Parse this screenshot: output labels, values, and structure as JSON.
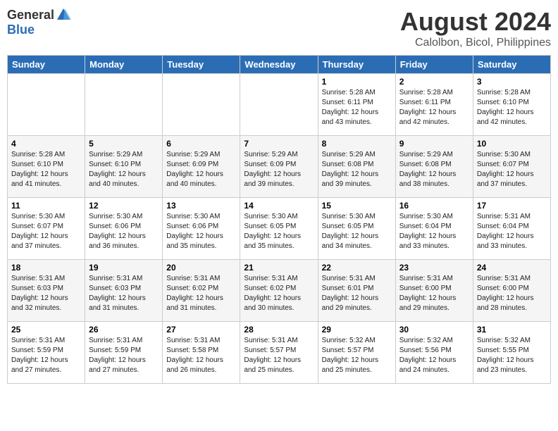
{
  "header": {
    "logo_general": "General",
    "logo_blue": "Blue",
    "month_year": "August 2024",
    "location": "Calolbon, Bicol, Philippines"
  },
  "days_of_week": [
    "Sunday",
    "Monday",
    "Tuesday",
    "Wednesday",
    "Thursday",
    "Friday",
    "Saturday"
  ],
  "weeks": [
    [
      {
        "day": "",
        "info": ""
      },
      {
        "day": "",
        "info": ""
      },
      {
        "day": "",
        "info": ""
      },
      {
        "day": "",
        "info": ""
      },
      {
        "day": "1",
        "info": "Sunrise: 5:28 AM\nSunset: 6:11 PM\nDaylight: 12 hours\nand 43 minutes."
      },
      {
        "day": "2",
        "info": "Sunrise: 5:28 AM\nSunset: 6:11 PM\nDaylight: 12 hours\nand 42 minutes."
      },
      {
        "day": "3",
        "info": "Sunrise: 5:28 AM\nSunset: 6:10 PM\nDaylight: 12 hours\nand 42 minutes."
      }
    ],
    [
      {
        "day": "4",
        "info": "Sunrise: 5:28 AM\nSunset: 6:10 PM\nDaylight: 12 hours\nand 41 minutes."
      },
      {
        "day": "5",
        "info": "Sunrise: 5:29 AM\nSunset: 6:10 PM\nDaylight: 12 hours\nand 40 minutes."
      },
      {
        "day": "6",
        "info": "Sunrise: 5:29 AM\nSunset: 6:09 PM\nDaylight: 12 hours\nand 40 minutes."
      },
      {
        "day": "7",
        "info": "Sunrise: 5:29 AM\nSunset: 6:09 PM\nDaylight: 12 hours\nand 39 minutes."
      },
      {
        "day": "8",
        "info": "Sunrise: 5:29 AM\nSunset: 6:08 PM\nDaylight: 12 hours\nand 39 minutes."
      },
      {
        "day": "9",
        "info": "Sunrise: 5:29 AM\nSunset: 6:08 PM\nDaylight: 12 hours\nand 38 minutes."
      },
      {
        "day": "10",
        "info": "Sunrise: 5:30 AM\nSunset: 6:07 PM\nDaylight: 12 hours\nand 37 minutes."
      }
    ],
    [
      {
        "day": "11",
        "info": "Sunrise: 5:30 AM\nSunset: 6:07 PM\nDaylight: 12 hours\nand 37 minutes."
      },
      {
        "day": "12",
        "info": "Sunrise: 5:30 AM\nSunset: 6:06 PM\nDaylight: 12 hours\nand 36 minutes."
      },
      {
        "day": "13",
        "info": "Sunrise: 5:30 AM\nSunset: 6:06 PM\nDaylight: 12 hours\nand 35 minutes."
      },
      {
        "day": "14",
        "info": "Sunrise: 5:30 AM\nSunset: 6:05 PM\nDaylight: 12 hours\nand 35 minutes."
      },
      {
        "day": "15",
        "info": "Sunrise: 5:30 AM\nSunset: 6:05 PM\nDaylight: 12 hours\nand 34 minutes."
      },
      {
        "day": "16",
        "info": "Sunrise: 5:30 AM\nSunset: 6:04 PM\nDaylight: 12 hours\nand 33 minutes."
      },
      {
        "day": "17",
        "info": "Sunrise: 5:31 AM\nSunset: 6:04 PM\nDaylight: 12 hours\nand 33 minutes."
      }
    ],
    [
      {
        "day": "18",
        "info": "Sunrise: 5:31 AM\nSunset: 6:03 PM\nDaylight: 12 hours\nand 32 minutes."
      },
      {
        "day": "19",
        "info": "Sunrise: 5:31 AM\nSunset: 6:03 PM\nDaylight: 12 hours\nand 31 minutes."
      },
      {
        "day": "20",
        "info": "Sunrise: 5:31 AM\nSunset: 6:02 PM\nDaylight: 12 hours\nand 31 minutes."
      },
      {
        "day": "21",
        "info": "Sunrise: 5:31 AM\nSunset: 6:02 PM\nDaylight: 12 hours\nand 30 minutes."
      },
      {
        "day": "22",
        "info": "Sunrise: 5:31 AM\nSunset: 6:01 PM\nDaylight: 12 hours\nand 29 minutes."
      },
      {
        "day": "23",
        "info": "Sunrise: 5:31 AM\nSunset: 6:00 PM\nDaylight: 12 hours\nand 29 minutes."
      },
      {
        "day": "24",
        "info": "Sunrise: 5:31 AM\nSunset: 6:00 PM\nDaylight: 12 hours\nand 28 minutes."
      }
    ],
    [
      {
        "day": "25",
        "info": "Sunrise: 5:31 AM\nSunset: 5:59 PM\nDaylight: 12 hours\nand 27 minutes."
      },
      {
        "day": "26",
        "info": "Sunrise: 5:31 AM\nSunset: 5:59 PM\nDaylight: 12 hours\nand 27 minutes."
      },
      {
        "day": "27",
        "info": "Sunrise: 5:31 AM\nSunset: 5:58 PM\nDaylight: 12 hours\nand 26 minutes."
      },
      {
        "day": "28",
        "info": "Sunrise: 5:31 AM\nSunset: 5:57 PM\nDaylight: 12 hours\nand 25 minutes."
      },
      {
        "day": "29",
        "info": "Sunrise: 5:32 AM\nSunset: 5:57 PM\nDaylight: 12 hours\nand 25 minutes."
      },
      {
        "day": "30",
        "info": "Sunrise: 5:32 AM\nSunset: 5:56 PM\nDaylight: 12 hours\nand 24 minutes."
      },
      {
        "day": "31",
        "info": "Sunrise: 5:32 AM\nSunset: 5:55 PM\nDaylight: 12 hours\nand 23 minutes."
      }
    ]
  ]
}
